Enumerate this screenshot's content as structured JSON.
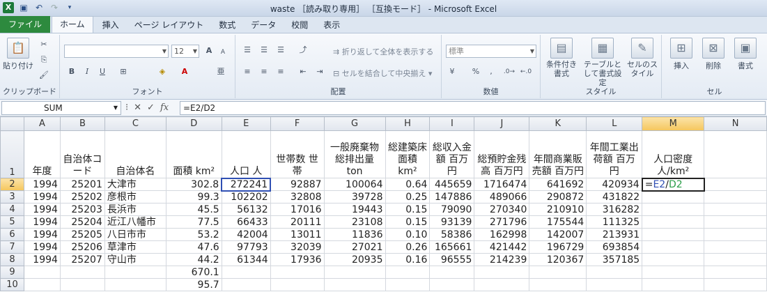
{
  "window": {
    "title": "waste ［読み取り専用］ ［互換モード］ - Microsoft Excel"
  },
  "tabs": [
    "ファイル",
    "ホーム",
    "挿入",
    "ページ レイアウト",
    "数式",
    "データ",
    "校閲",
    "表示"
  ],
  "ribbon": {
    "clipboard": {
      "label": "クリップボード",
      "paste": "貼り付け"
    },
    "font": {
      "label": "フォント",
      "size": "12",
      "grow": "A",
      "shrink": "A",
      "bold": "B",
      "italic": "I",
      "underline": "U"
    },
    "alignment": {
      "label": "配置",
      "wrap": "折り返して全体を表示する",
      "merge": "セルを結合して中央揃え"
    },
    "number": {
      "label": "数値",
      "format": "標準",
      "percent": "%"
    },
    "styles": {
      "label": "スタイル",
      "conditional": "条件付き書式",
      "table": "テーブルとして書式設定",
      "cell_styles": "セルのスタイル"
    },
    "cells": {
      "label": "セル",
      "insert": "挿入",
      "delete": "削除",
      "format": "書式"
    }
  },
  "formula_bar": {
    "name_box": "SUM",
    "formula": "=E2/D2"
  },
  "grid": {
    "columns": [
      "A",
      "B",
      "C",
      "D",
      "E",
      "F",
      "G",
      "H",
      "I",
      "J",
      "K",
      "L",
      "M",
      "N"
    ],
    "headers": [
      "年度",
      "自治体コード",
      "自治体名",
      "面積 km²",
      "人口 人",
      "世帯数 世帯",
      "一般廃棄物総排出量 ton",
      "総建築床面積 km²",
      "総収入金額 百万円",
      "総預貯金残高 百万円",
      "年間商業販売額 百万円",
      "年間工業出荷額 百万円",
      "人口密度 人/km²",
      ""
    ],
    "rows": [
      [
        "1994",
        "25201",
        "大津市",
        "302.8",
        "272241",
        "92887",
        "100064",
        "0.64",
        "445659",
        "1716474",
        "641692",
        "420934",
        "",
        ""
      ],
      [
        "1994",
        "25202",
        "彦根市",
        "99.3",
        "102202",
        "32808",
        "39728",
        "0.25",
        "147886",
        "489066",
        "290872",
        "431822",
        "",
        ""
      ],
      [
        "1994",
        "25203",
        "長浜市",
        "45.5",
        "56132",
        "17016",
        "19443",
        "0.15",
        "79090",
        "270340",
        "210910",
        "316282",
        "",
        ""
      ],
      [
        "1994",
        "25204",
        "近江八幡市",
        "77.5",
        "66433",
        "20111",
        "23108",
        "0.15",
        "93139",
        "271796",
        "175544",
        "111325",
        "",
        ""
      ],
      [
        "1994",
        "25205",
        "八日市市",
        "53.2",
        "42004",
        "13011",
        "11836",
        "0.10",
        "58386",
        "162998",
        "142007",
        "213931",
        "",
        ""
      ],
      [
        "1994",
        "25206",
        "草津市",
        "47.6",
        "97793",
        "32039",
        "27021",
        "0.26",
        "165661",
        "421442",
        "196729",
        "693854",
        "",
        ""
      ],
      [
        "1994",
        "25207",
        "守山市",
        "44.2",
        "61344",
        "17936",
        "20935",
        "0.16",
        "96555",
        "214239",
        "120367",
        "357185",
        "",
        ""
      ],
      [
        "",
        "",
        "",
        "670.1",
        "",
        "",
        "",
        "",
        "",
        "",
        "",
        "",
        "",
        ""
      ],
      [
        "",
        "",
        "",
        "95.7",
        "",
        "",
        "",
        "",
        "",
        "",
        "",
        "",
        "",
        ""
      ]
    ],
    "editing_cell": {
      "prefix": "=",
      "ref1": "E2",
      "op": "/",
      "ref2": "D2"
    }
  }
}
